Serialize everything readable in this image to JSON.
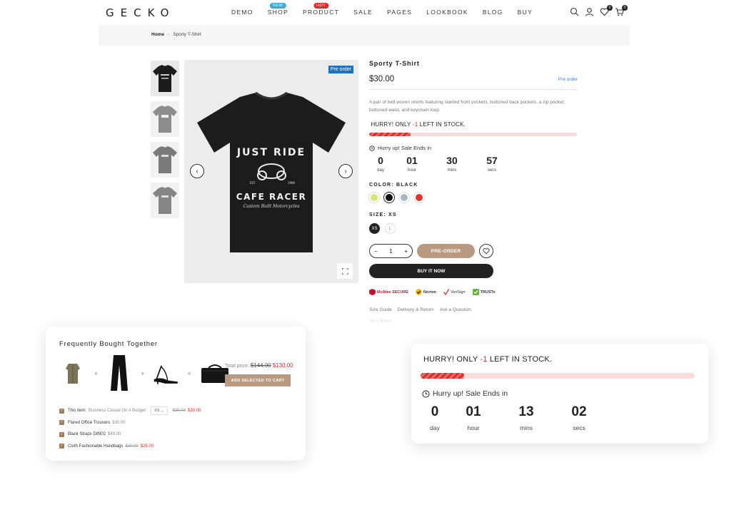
{
  "header": {
    "logo": "GECKO",
    "nav": [
      {
        "label": "DEMO",
        "badge": null
      },
      {
        "label": "SHOP",
        "badge": "NEW",
        "badge_color": "#3ba9e0"
      },
      {
        "label": "PRODUCT",
        "badge": "HOT",
        "badge_color": "#e02b2b"
      },
      {
        "label": "SALE",
        "badge": null
      },
      {
        "label": "PAGES",
        "badge": null
      },
      {
        "label": "LOOKBOOK",
        "badge": null
      },
      {
        "label": "BLOG",
        "badge": null
      },
      {
        "label": "BUY",
        "badge": null
      }
    ],
    "icons": [
      "search-icon",
      "user-icon",
      "heart-icon",
      "cart-icon"
    ],
    "wishlist_count": "0",
    "cart_count": "0"
  },
  "breadcrumb": {
    "home": "Home",
    "separator": "›",
    "current": "Sporty T-Shirt"
  },
  "gallery": {
    "preorder_badge": "Pre order",
    "shirt_text": {
      "line1": "JUST RIDE",
      "est": "EST.",
      "year": "1989",
      "line2": "CAFE RACER",
      "line3": "Custom Built Motorcycles"
    }
  },
  "product": {
    "title": "Sporty T-Shirt",
    "price": "$30.00",
    "preorder_link": "Pre order",
    "description": "A pair of twill woven shorts featuring slanted front pockets, buttoned back pockets, a zip pocket, buttoned waist, and keychain loop.",
    "stock": {
      "prefix": "HURRY! ONLY ",
      "count": "-1",
      "suffix": " LEFT IN STOCK.",
      "progress": 0.2
    },
    "sale_ends_label": "Hurry up! Sale Ends in",
    "countdown": [
      {
        "value": "0",
        "label": "day"
      },
      {
        "value": "01",
        "label": "hour"
      },
      {
        "value": "30",
        "label": "mins"
      },
      {
        "value": "57",
        "label": "secs"
      }
    ],
    "color_label": "COLOR: BLACK",
    "colors": [
      {
        "name": "lime",
        "hex": "#d9e86a",
        "selected": false
      },
      {
        "name": "black",
        "hex": "#111111",
        "selected": true
      },
      {
        "name": "grey-blue",
        "hex": "#a9b8c4",
        "selected": false
      },
      {
        "name": "red",
        "hex": "#e8312a",
        "selected": false
      }
    ],
    "size_label": "SIZE: XS",
    "sizes": [
      {
        "label": "XS",
        "selected": true
      },
      {
        "label": "L",
        "selected": false
      }
    ],
    "quantity": "1",
    "qty_minus": "−",
    "qty_plus": "+",
    "preorder_button": "PRE-ORDER",
    "buy_now_button": "BUY IT NOW",
    "trust_badges": [
      {
        "name": "mcafee",
        "label": "McAfee SECURE",
        "color": "#c8102e"
      },
      {
        "name": "norton",
        "label": "Norton",
        "color": "#f2b200"
      },
      {
        "name": "verisign",
        "label": "VeriSign",
        "color": "#2a2a2a"
      },
      {
        "name": "truste",
        "label": "TRUSTe",
        "color": "#6ab23e"
      }
    ],
    "links": [
      "Size Guide",
      "Delivery & Return",
      "Ask a Question"
    ],
    "faded_text": "SKU: BKLA"
  },
  "fbt": {
    "title": "Frequently Bought Together",
    "total_label": "Total price:",
    "total_old": "$144.00",
    "total_new": "$130.00",
    "add_button": "ADD SELECTED TO CART",
    "items": [
      {
        "name": "This item:",
        "variant": "Business Casual On A Budget",
        "select": "XS",
        "old_price": "$39.00",
        "price": "$30.00"
      },
      {
        "name": "Flared Office Trousers",
        "variant": "",
        "select": "",
        "old_price": "",
        "price": "$30.00"
      },
      {
        "name": "Black Straps D8902",
        "variant": "",
        "select": "",
        "old_price": "",
        "price": "$45.00"
      },
      {
        "name": "Cloth Fashionable Handbags",
        "variant": "",
        "select": "",
        "old_price": "$30.00",
        "price": "$25.00"
      }
    ]
  },
  "big_card": {
    "stock": {
      "prefix": "HURRY! ONLY ",
      "count": "-1",
      "suffix": " LEFT IN STOCK.",
      "progress": 0.16
    },
    "sale_ends_label": "Hurry up! Sale Ends in",
    "countdown": [
      {
        "value": "0",
        "label": "day"
      },
      {
        "value": "01",
        "label": "hour"
      },
      {
        "value": "13",
        "label": "mins"
      },
      {
        "value": "02",
        "label": "secs"
      }
    ]
  }
}
